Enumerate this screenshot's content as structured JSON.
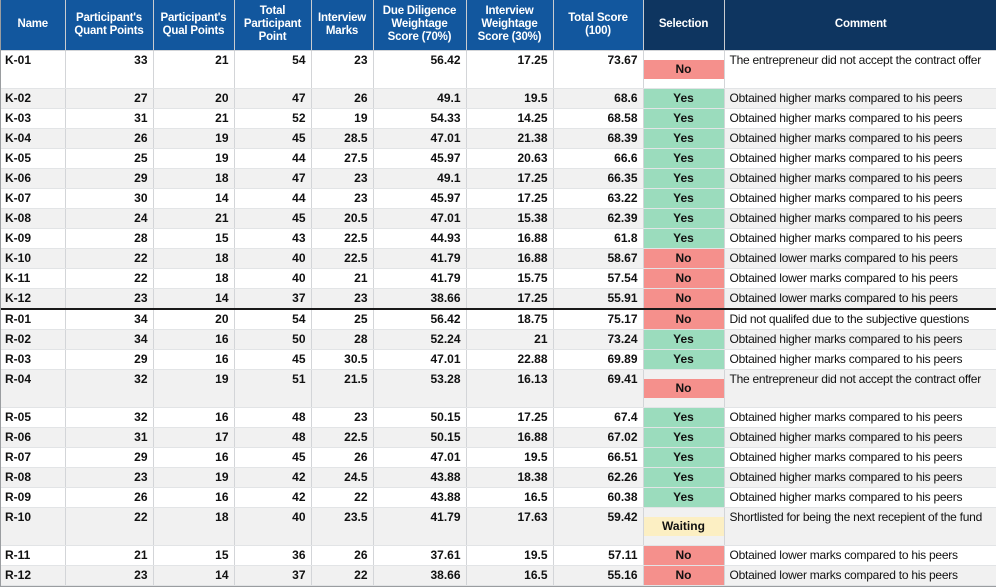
{
  "table": {
    "columns": [
      {
        "id": "name",
        "label": "Name",
        "style": "normal"
      },
      {
        "id": "quant",
        "label": "Participant's Quant Points",
        "style": "normal"
      },
      {
        "id": "qual",
        "label": "Participant's Qual Points",
        "style": "normal"
      },
      {
        "id": "total_point",
        "label": "Total Participant Point",
        "style": "normal"
      },
      {
        "id": "interview",
        "label": "Interview Marks",
        "style": "normal"
      },
      {
        "id": "dd70",
        "label": "Due Diligence Weightage Score (70%)",
        "style": "normal"
      },
      {
        "id": "iw30",
        "label": "Interview Weightage Score (30%)",
        "style": "normal"
      },
      {
        "id": "total_score",
        "label": "Total Score (100)",
        "style": "normal"
      },
      {
        "id": "selection",
        "label": "Selection",
        "style": "dark"
      },
      {
        "id": "comment",
        "label": "Comment",
        "style": "dark"
      }
    ],
    "colors": {
      "header_blue": "#12579E",
      "header_dark_blue": "#0E3560",
      "yes_green": "#9BDCBD",
      "no_red": "#F5908C",
      "waiting_yellow": "#FCEFC3",
      "row_stripe": "#f1f1f1",
      "row_base": "#ffffff"
    },
    "selection_labels": {
      "yes": "Yes",
      "no": "No",
      "waiting": "Waiting"
    },
    "rows": [
      {
        "name": "K-01",
        "quant": "33",
        "qual": "21",
        "total_point": "54",
        "interview": "23",
        "dd70": "56.42",
        "iw30": "17.25",
        "total_score": "73.67",
        "selection": "No",
        "selection_state": "no",
        "comment": "The entrepreneur did not accept the contract offer",
        "tall": true,
        "group_end": false
      },
      {
        "name": "K-02",
        "quant": "27",
        "qual": "20",
        "total_point": "47",
        "interview": "26",
        "dd70": "49.1",
        "iw30": "19.5",
        "total_score": "68.6",
        "selection": "Yes",
        "selection_state": "yes",
        "comment": "Obtained higher marks compared to his peers",
        "tall": false,
        "group_end": false
      },
      {
        "name": "K-03",
        "quant": "31",
        "qual": "21",
        "total_point": "52",
        "interview": "19",
        "dd70": "54.33",
        "iw30": "14.25",
        "total_score": "68.58",
        "selection": "Yes",
        "selection_state": "yes",
        "comment": "Obtained higher marks compared to his peers",
        "tall": false,
        "group_end": false
      },
      {
        "name": "K-04",
        "quant": "26",
        "qual": "19",
        "total_point": "45",
        "interview": "28.5",
        "dd70": "47.01",
        "iw30": "21.38",
        "total_score": "68.39",
        "selection": "Yes",
        "selection_state": "yes",
        "comment": "Obtained higher marks compared to his peers",
        "tall": false,
        "group_end": false
      },
      {
        "name": "K-05",
        "quant": "25",
        "qual": "19",
        "total_point": "44",
        "interview": "27.5",
        "dd70": "45.97",
        "iw30": "20.63",
        "total_score": "66.6",
        "selection": "Yes",
        "selection_state": "yes",
        "comment": "Obtained higher marks compared to his peers",
        "tall": false,
        "group_end": false
      },
      {
        "name": "K-06",
        "quant": "29",
        "qual": "18",
        "total_point": "47",
        "interview": "23",
        "dd70": "49.1",
        "iw30": "17.25",
        "total_score": "66.35",
        "selection": "Yes",
        "selection_state": "yes",
        "comment": "Obtained higher marks compared to his peers",
        "tall": false,
        "group_end": false
      },
      {
        "name": "K-07",
        "quant": "30",
        "qual": "14",
        "total_point": "44",
        "interview": "23",
        "dd70": "45.97",
        "iw30": "17.25",
        "total_score": "63.22",
        "selection": "Yes",
        "selection_state": "yes",
        "comment": "Obtained higher marks compared to his peers",
        "tall": false,
        "group_end": false
      },
      {
        "name": "K-08",
        "quant": "24",
        "qual": "21",
        "total_point": "45",
        "interview": "20.5",
        "dd70": "47.01",
        "iw30": "15.38",
        "total_score": "62.39",
        "selection": "Yes",
        "selection_state": "yes",
        "comment": "Obtained higher marks compared to his peers",
        "tall": false,
        "group_end": false
      },
      {
        "name": "K-09",
        "quant": "28",
        "qual": "15",
        "total_point": "43",
        "interview": "22.5",
        "dd70": "44.93",
        "iw30": "16.88",
        "total_score": "61.8",
        "selection": "Yes",
        "selection_state": "yes",
        "comment": "Obtained higher marks compared to his peers",
        "tall": false,
        "group_end": false
      },
      {
        "name": "K-10",
        "quant": "22",
        "qual": "18",
        "total_point": "40",
        "interview": "22.5",
        "dd70": "41.79",
        "iw30": "16.88",
        "total_score": "58.67",
        "selection": "No",
        "selection_state": "no",
        "comment": "Obtained lower marks compared to his peers",
        "tall": false,
        "group_end": false
      },
      {
        "name": "K-11",
        "quant": "22",
        "qual": "18",
        "total_point": "40",
        "interview": "21",
        "dd70": "41.79",
        "iw30": "15.75",
        "total_score": "57.54",
        "selection": "No",
        "selection_state": "no",
        "comment": "Obtained lower marks compared to his peers",
        "tall": false,
        "group_end": false
      },
      {
        "name": "K-12",
        "quant": "23",
        "qual": "14",
        "total_point": "37",
        "interview": "23",
        "dd70": "38.66",
        "iw30": "17.25",
        "total_score": "55.91",
        "selection": "No",
        "selection_state": "no",
        "comment": "Obtained lower marks compared to his peers",
        "tall": false,
        "group_end": true
      },
      {
        "name": "R-01",
        "quant": "34",
        "qual": "20",
        "total_point": "54",
        "interview": "25",
        "dd70": "56.42",
        "iw30": "18.75",
        "total_score": "75.17",
        "selection": "No",
        "selection_state": "no",
        "comment": "Did not qualifed due to the subjective questions",
        "tall": false,
        "group_end": false
      },
      {
        "name": "R-02",
        "quant": "34",
        "qual": "16",
        "total_point": "50",
        "interview": "28",
        "dd70": "52.24",
        "iw30": "21",
        "total_score": "73.24",
        "selection": "Yes",
        "selection_state": "yes",
        "comment": "Obtained higher marks compared to his peers",
        "tall": false,
        "group_end": false
      },
      {
        "name": "R-03",
        "quant": "29",
        "qual": "16",
        "total_point": "45",
        "interview": "30.5",
        "dd70": "47.01",
        "iw30": "22.88",
        "total_score": "69.89",
        "selection": "Yes",
        "selection_state": "yes",
        "comment": "Obtained higher marks compared to his peers",
        "tall": false,
        "group_end": false
      },
      {
        "name": "R-04",
        "quant": "32",
        "qual": "19",
        "total_point": "51",
        "interview": "21.5",
        "dd70": "53.28",
        "iw30": "16.13",
        "total_score": "69.41",
        "selection": "No",
        "selection_state": "no",
        "comment": "The entrepreneur did not accept the contract offer",
        "tall": true,
        "group_end": false
      },
      {
        "name": "R-05",
        "quant": "32",
        "qual": "16",
        "total_point": "48",
        "interview": "23",
        "dd70": "50.15",
        "iw30": "17.25",
        "total_score": "67.4",
        "selection": "Yes",
        "selection_state": "yes",
        "comment": "Obtained higher marks compared to his peers",
        "tall": false,
        "group_end": false
      },
      {
        "name": "R-06",
        "quant": "31",
        "qual": "17",
        "total_point": "48",
        "interview": "22.5",
        "dd70": "50.15",
        "iw30": "16.88",
        "total_score": "67.02",
        "selection": "Yes",
        "selection_state": "yes",
        "comment": "Obtained higher marks compared to his peers",
        "tall": false,
        "group_end": false
      },
      {
        "name": "R-07",
        "quant": "29",
        "qual": "16",
        "total_point": "45",
        "interview": "26",
        "dd70": "47.01",
        "iw30": "19.5",
        "total_score": "66.51",
        "selection": "Yes",
        "selection_state": "yes",
        "comment": "Obtained higher marks compared to his peers",
        "tall": false,
        "group_end": false
      },
      {
        "name": "R-08",
        "quant": "23",
        "qual": "19",
        "total_point": "42",
        "interview": "24.5",
        "dd70": "43.88",
        "iw30": "18.38",
        "total_score": "62.26",
        "selection": "Yes",
        "selection_state": "yes",
        "comment": "Obtained higher marks compared to his peers",
        "tall": false,
        "group_end": false
      },
      {
        "name": "R-09",
        "quant": "26",
        "qual": "16",
        "total_point": "42",
        "interview": "22",
        "dd70": "43.88",
        "iw30": "16.5",
        "total_score": "60.38",
        "selection": "Yes",
        "selection_state": "yes",
        "comment": "Obtained higher marks compared to his peers",
        "tall": false,
        "group_end": false
      },
      {
        "name": "R-10",
        "quant": "22",
        "qual": "18",
        "total_point": "40",
        "interview": "23.5",
        "dd70": "41.79",
        "iw30": "17.63",
        "total_score": "59.42",
        "selection": "Waiting",
        "selection_state": "waiting",
        "comment": "Shortlisted for being the next recepient of the fund",
        "tall": true,
        "group_end": false
      },
      {
        "name": "R-11",
        "quant": "21",
        "qual": "15",
        "total_point": "36",
        "interview": "26",
        "dd70": "37.61",
        "iw30": "19.5",
        "total_score": "57.11",
        "selection": "No",
        "selection_state": "no",
        "comment": "Obtained lower marks compared to his peers",
        "tall": false,
        "group_end": false
      },
      {
        "name": "R-12",
        "quant": "23",
        "qual": "14",
        "total_point": "37",
        "interview": "22",
        "dd70": "38.66",
        "iw30": "16.5",
        "total_score": "55.16",
        "selection": "No",
        "selection_state": "no",
        "comment": "Obtained lower marks compared to his peers",
        "tall": false,
        "group_end": false
      }
    ]
  }
}
